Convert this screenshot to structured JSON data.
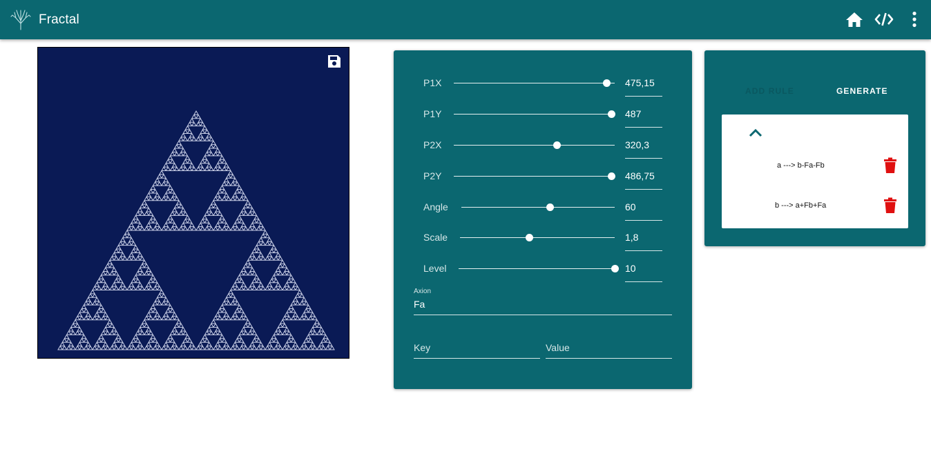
{
  "app": {
    "title": "Fractal"
  },
  "toolbar": {
    "home_icon": "home-icon",
    "code_icon": "code-icon",
    "menu_icon": "more-vert-icon"
  },
  "canvas": {
    "background": "#0a1a55",
    "stroke": "#c9cfe6",
    "save_icon": "save-icon"
  },
  "params": {
    "sliders": [
      {
        "label": "P1X",
        "value": "475,15",
        "fraction": 0.95
      },
      {
        "label": "P1Y",
        "value": "487",
        "fraction": 0.98
      },
      {
        "label": "P2X",
        "value": "320,3",
        "fraction": 0.64
      },
      {
        "label": "P2Y",
        "value": "486,75",
        "fraction": 0.98
      },
      {
        "label": "Angle",
        "value": "60",
        "fraction": 0.58
      },
      {
        "label": "Scale",
        "value": "1,8",
        "fraction": 0.45
      },
      {
        "label": "Level",
        "value": "10",
        "fraction": 1.0
      }
    ],
    "axion_label": "Axion",
    "axion_value": "Fa",
    "key_placeholder": "Key",
    "value_placeholder": "Value"
  },
  "rules": {
    "add_rule_label": "ADD RULE",
    "generate_label": "GENERATE",
    "items": [
      {
        "text": "a ---> b-Fa-Fb"
      },
      {
        "text": "b ---> a+Fb+Fa"
      }
    ]
  },
  "colors": {
    "appbar": "#0b6770",
    "panel": "#0b6770",
    "trash": "#e01010",
    "chevron": "#0b6770"
  }
}
